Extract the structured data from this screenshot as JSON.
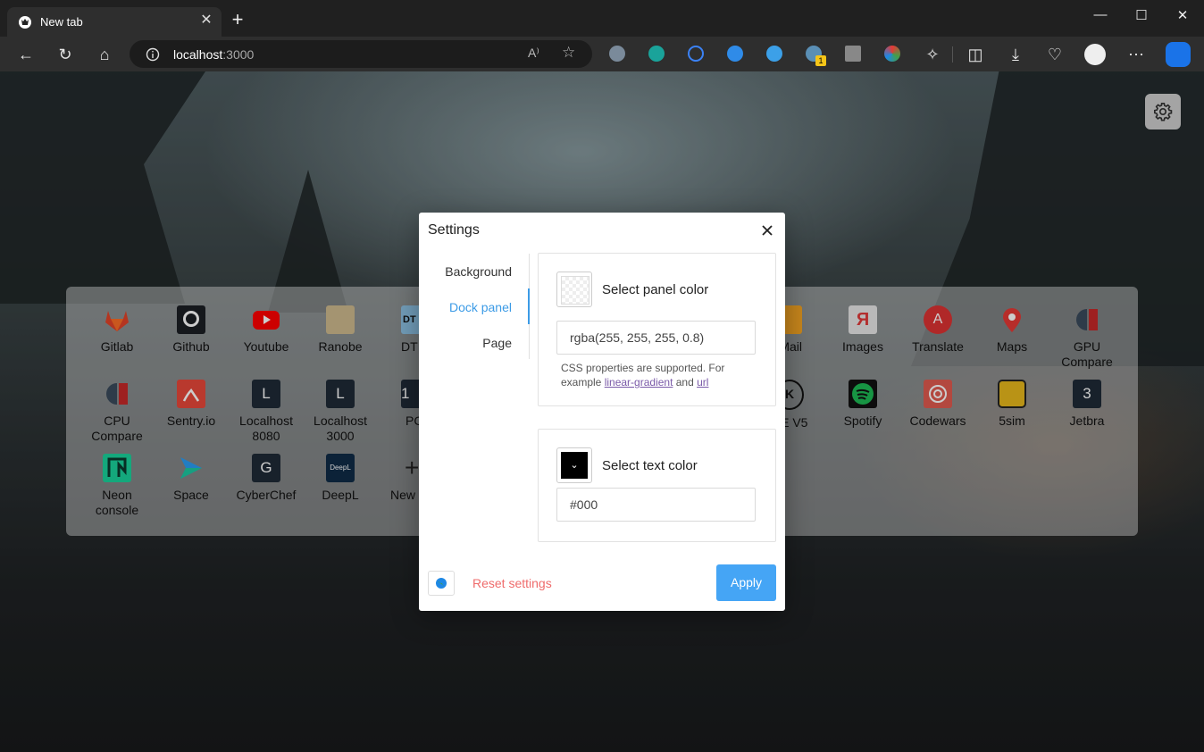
{
  "browser": {
    "tab_title": "New tab",
    "url_host": "localhost",
    "url_port": ":3000",
    "read_aloud": "A⁾",
    "profile_badge": "1"
  },
  "colors": {
    "accent": "#3c9be6",
    "apply_button": "#45a5f5",
    "reset_text": "#ef6b6b",
    "dock_bg": "rgba(255,255,255,0.42)"
  },
  "dock": {
    "items": [
      {
        "label": "Gitlab",
        "icon": "gitlab-icon",
        "color": "#e24329"
      },
      {
        "label": "Github",
        "icon": "github-icon",
        "color": "#1b1f23"
      },
      {
        "label": "Youtube",
        "icon": "youtube-icon",
        "color": "#ff0000"
      },
      {
        "label": "Ranobe",
        "icon": "book-icon",
        "color": "#c9b48a"
      },
      {
        "label": "DT",
        "icon": "dt-icon",
        "color": "#5aa5d8",
        "text": "DT"
      },
      {
        "label": "Mail",
        "icon": "mail-icon",
        "color": "#f5a623"
      },
      {
        "label": "Images",
        "icon": "yandex-images-icon",
        "color": "#e03a3a",
        "text": "Я"
      },
      {
        "label": "Translate",
        "icon": "translate-icon",
        "color": "#d33",
        "text": "A"
      },
      {
        "label": "Maps",
        "icon": "maps-pin-icon",
        "color": "#e53935"
      },
      {
        "label": "GPU Compare",
        "icon": "gpu-compare-icon",
        "color": "#c62828"
      },
      {
        "label": "CPU Compare",
        "icon": "cpu-compare-icon",
        "color": "#c62828"
      },
      {
        "label": "Sentry.io",
        "icon": "sentry-icon",
        "color": "#e8483a"
      },
      {
        "label": "Localhost 8080",
        "icon": "letter-l-icon",
        "text": "L"
      },
      {
        "label": "Localhost 3000",
        "icon": "letter-l-icon",
        "text": "L"
      },
      {
        "label": "PC",
        "icon": "number-1-icon",
        "text": "1"
      },
      {
        "label": "CE V5",
        "icon": "k-circle-icon",
        "color": "#111",
        "text": "K"
      },
      {
        "label": "Spotify",
        "icon": "spotify-icon",
        "color": "#1db954"
      },
      {
        "label": "Codewars",
        "icon": "codewars-icon",
        "color": "#e05a4f"
      },
      {
        "label": "5sim",
        "icon": "sim-card-icon",
        "color": "#e8b81c"
      },
      {
        "label": "Jetbra",
        "icon": "number-3-icon",
        "text": "3"
      },
      {
        "label": "Neon console",
        "icon": "neon-icon",
        "color": "#1ad39b"
      },
      {
        "label": "Space",
        "icon": "space-icon",
        "color": "#2a9df4"
      },
      {
        "label": "CyberChef",
        "icon": "letter-g-icon",
        "text": "G"
      },
      {
        "label": "DeepL",
        "icon": "deepl-icon",
        "color": "#0f2b46",
        "text": "DeepL"
      },
      {
        "label": "New",
        "icon": "plus-icon",
        "text": "+"
      }
    ],
    "labels": {
      "gitlab": "Gitlab",
      "github": "Github",
      "youtube": "Youtube",
      "ranobe": "Ranobe",
      "dt": "DT",
      "mail": "Mail",
      "images": "Images",
      "translate": "Translate",
      "maps": "Maps",
      "gpu": "GPU Compare",
      "cpu": "CPU Compare",
      "sentry": "Sentry.io",
      "lh8080": "Localhost 8080",
      "lh3000": "Localhost 3000",
      "pc": "PC",
      "cev5": "CE V5",
      "spotify": "Spotify",
      "codewars": "Codewars",
      "fivesim": "5sim",
      "jetbra": "Jetbra",
      "neon": "Neon console",
      "space": "Space",
      "cyberchef": "CyberChef",
      "deepl": "DeepL",
      "new": "New"
    },
    "glyphs": {
      "l": "L",
      "one": "1",
      "three": "3",
      "g": "G",
      "dt": "DT",
      "ya": "Я",
      "k": "K",
      "deepl": "DeepL",
      "plus": "+"
    }
  },
  "settings": {
    "title": "Settings",
    "tabs": [
      "Background",
      "Dock panel",
      "Page"
    ],
    "active_tab": "Dock panel",
    "panel_color": {
      "label": "Select panel color",
      "value": "rgba(255, 255, 255, 0.8)",
      "hint_prefix": "CSS properties are supported. For example ",
      "link1": "linear-gradient",
      "hint_mid": " and ",
      "link2": "url"
    },
    "text_color": {
      "label": "Select text color",
      "value": "#000"
    },
    "reset_label": "Reset settings",
    "apply_label": "Apply"
  }
}
